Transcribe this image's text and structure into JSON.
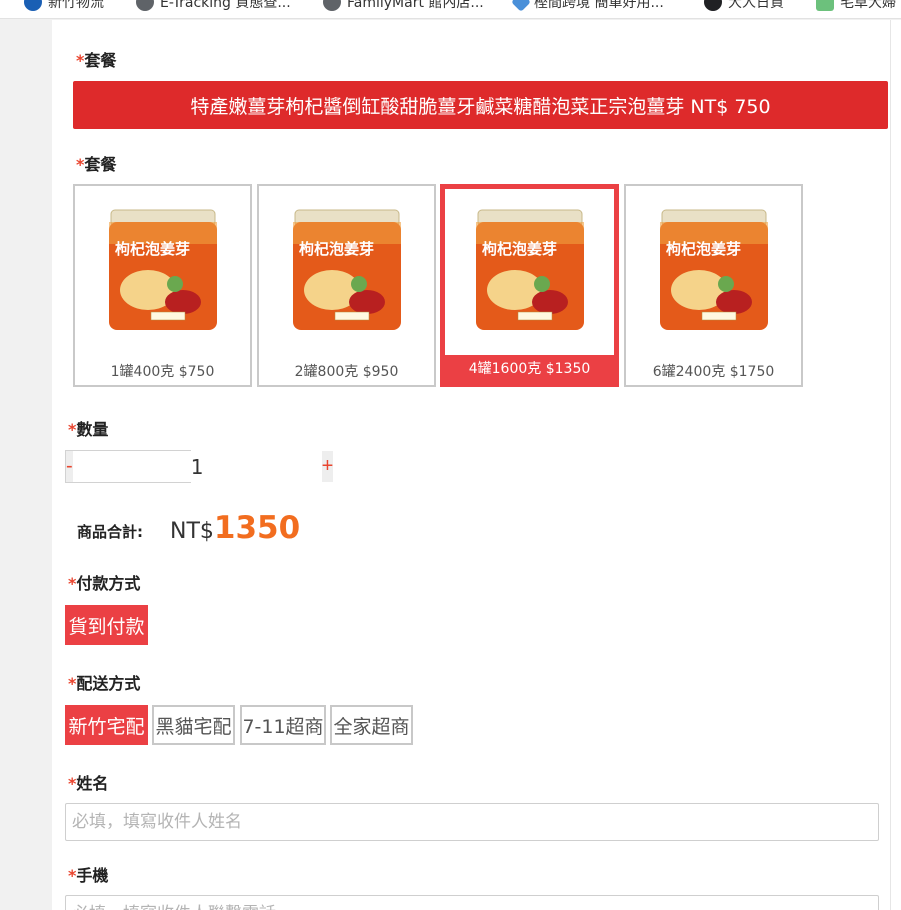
{
  "bookmarks": [
    {
      "label": "新竹物流",
      "icon": "bookmark-icon"
    },
    {
      "label": "E-Tracking 貨態查...",
      "icon": "bookmark-icon"
    },
    {
      "label": "FamilyMart 館內店...",
      "icon": "bookmark-icon"
    },
    {
      "label": "樫間跨境 簡單好用...",
      "icon": "bookmark-icon"
    },
    {
      "label": "大人日貨",
      "icon": "bookmark-icon"
    },
    {
      "label": "毛草大婦",
      "icon": "bookmark-icon"
    }
  ],
  "form": {
    "required_mark": "*",
    "package_label_1": "套餐",
    "selected_product": "特產嫩薑芽枸杞醬倒缸酸甜脆薑牙鹹菜糖醋泡菜正宗泡薑芽 NT$ 750",
    "package_label_2": "套餐",
    "packages": [
      {
        "caption": "1罐400克 $750",
        "selected": false
      },
      {
        "caption": "2罐800克 $950",
        "selected": false
      },
      {
        "caption": "4罐1600克 $1350",
        "selected": true
      },
      {
        "caption": "6罐2400克 $1750",
        "selected": false
      }
    ],
    "product_jar_text": "枸杞泡姜芽",
    "quantity_label": "數量",
    "quantity_minus": "-",
    "quantity_value": "1",
    "quantity_plus": "+",
    "total_label": "商品合計:",
    "total_currency": "NT$",
    "total_amount": "1350",
    "payment_label": "付款方式",
    "payment_options": [
      {
        "label": "貨到付款",
        "selected": true
      }
    ],
    "delivery_label": "配送方式",
    "delivery_options": [
      {
        "label": "新竹宅配",
        "selected": true
      },
      {
        "label": "黑貓宅配",
        "selected": false
      },
      {
        "label": "7-11超商",
        "selected": false
      },
      {
        "label": "全家超商",
        "selected": false
      }
    ],
    "name_label": "姓名",
    "name_placeholder": "必填，填寫收件人姓名",
    "phone_label": "手機",
    "phone_placeholder": "必填，填寫收件人聯繫電話"
  },
  "colors": {
    "accent_red": "#eb4044",
    "banner_red": "#de2a2b",
    "price_orange": "#f26d1f"
  }
}
